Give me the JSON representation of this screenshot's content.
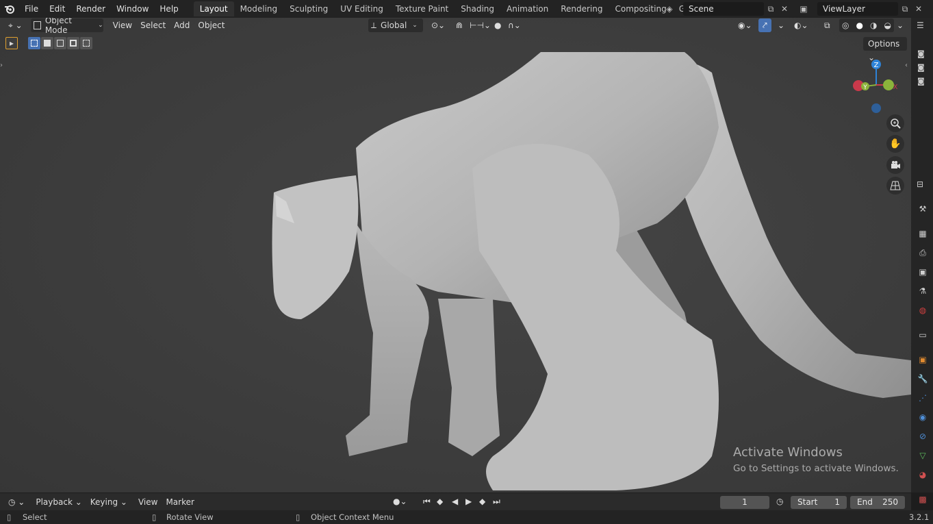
{
  "menu": [
    "File",
    "Edit",
    "Render",
    "Window",
    "Help"
  ],
  "workspaces": [
    {
      "label": "Layout",
      "active": true
    },
    {
      "label": "Modeling"
    },
    {
      "label": "Sculpting"
    },
    {
      "label": "UV Editing"
    },
    {
      "label": "Texture Paint"
    },
    {
      "label": "Shading"
    },
    {
      "label": "Animation"
    },
    {
      "label": "Rendering"
    },
    {
      "label": "Compositing"
    },
    {
      "label": "Geometry Noc"
    }
  ],
  "scene": {
    "name": "Scene"
  },
  "view_layer": {
    "name": "ViewLayer"
  },
  "viewport_header": {
    "mode": "Object Mode",
    "menus": [
      "View",
      "Select",
      "Add",
      "Object"
    ],
    "orientation": "Global"
  },
  "options_label": "Options",
  "gizmo": {
    "z": "Z",
    "y": "Y",
    "x": "X"
  },
  "watermark": {
    "title": "Activate Windows",
    "subtitle": "Go to Settings to activate Windows."
  },
  "timeline": {
    "menus": [
      "Playback",
      "Keying",
      "View",
      "Marker"
    ],
    "current_frame": "1",
    "start_label": "Start",
    "start": "1",
    "end_label": "End",
    "end": "250"
  },
  "statusbar": {
    "select": "Select",
    "rotate": "Rotate View",
    "context": "Object Context Menu",
    "version": "3.2.1"
  },
  "colors": {
    "accent": "#4772b3",
    "x_axis": "#c9394b",
    "y_axis": "#8bb33b",
    "z_axis": "#2e83d8"
  }
}
